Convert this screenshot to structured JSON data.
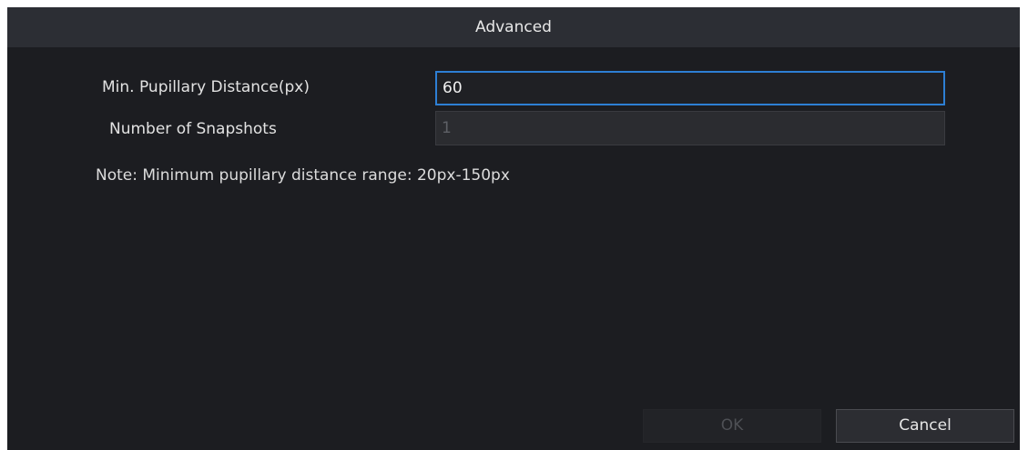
{
  "dialog": {
    "title": "Advanced"
  },
  "form": {
    "pupillary": {
      "label": "Min. Pupillary Distance(px)",
      "value": "60"
    },
    "snapshots": {
      "label": "Number of Snapshots",
      "value": "1"
    }
  },
  "note": "Note: Minimum pupillary distance range: 20px-150px",
  "buttons": {
    "ok": "OK",
    "cancel": "Cancel"
  },
  "colors": {
    "background": "#1c1d21",
    "titlebar": "#2c2e34",
    "focus_border": "#2d7fd4"
  }
}
